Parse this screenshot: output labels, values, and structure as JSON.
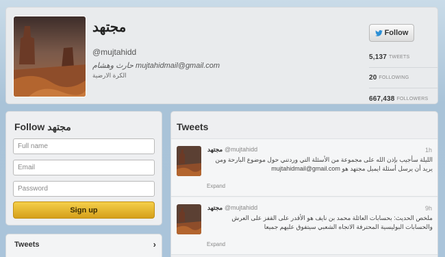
{
  "profile": {
    "display_name": "مجتهد",
    "screen_name": "@mujtahidd",
    "bio": "حارث وهشام mujtahidmail@gmail.com",
    "location": "الكرة الارضية",
    "follow_label": "Follow",
    "stats": [
      {
        "value": "5,137",
        "label": "TWEETS"
      },
      {
        "value": "20",
        "label": "FOLLOWING"
      },
      {
        "value": "667,438",
        "label": "FOLLOWERS"
      }
    ]
  },
  "follow_form": {
    "title": "Follow مجتهد",
    "full_name_placeholder": "Full name",
    "email_placeholder": "Email",
    "password_placeholder": "Password",
    "signup_label": "Sign up"
  },
  "nav": {
    "tweets_label": "Tweets",
    "chevron": "›"
  },
  "timeline": {
    "title": "Tweets",
    "tweets": [
      {
        "name": "مجتهد",
        "handle": "@mujtahidd",
        "time": "1h",
        "text": "الليلة سأجيب بإذن الله على مجموعة من الأسئلة التي وردتني حول موضوع البارحة ومن يريد أن يرسل أسئلة ايميل مجتهد هو mujtahidmail@gmail.com",
        "expand": "Expand"
      },
      {
        "name": "مجتهد",
        "handle": "@mujtahidd",
        "time": "9h",
        "text": "ملخص الحديث: بحسابات العائلة محمد بن نايف هو الأقدر على القفز على العرش والحسابات البوليسية المحترفة الاتجاه الشعبي سيتفوق عليهم جميعا",
        "expand": "Expand"
      }
    ]
  },
  "colors": {
    "signup_gold": "#d9a61e",
    "background": "#b9cfe0"
  }
}
